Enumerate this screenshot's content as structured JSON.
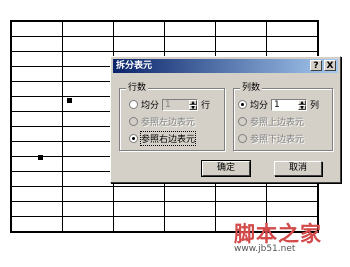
{
  "dialog": {
    "title": "拆分表元",
    "help_label": "?",
    "close_label": "X",
    "rows_group": {
      "label": "行数",
      "evenly_label": "均分",
      "evenly_value": "1",
      "unit_label": "行",
      "ref_left_label": "参照左边表元",
      "ref_right_label": "参照右边表元",
      "selected": "ref_right"
    },
    "cols_group": {
      "label": "列数",
      "evenly_label": "均分",
      "evenly_value": "1",
      "unit_label": "列",
      "ref_top_label": "参照上边表元",
      "ref_bottom_label": "参照下边表元",
      "selected": "evenly"
    },
    "ok_label": "确定",
    "cancel_label": "取消"
  },
  "watermark": {
    "brand": "脚本之家",
    "url": "www.jb51.net"
  }
}
